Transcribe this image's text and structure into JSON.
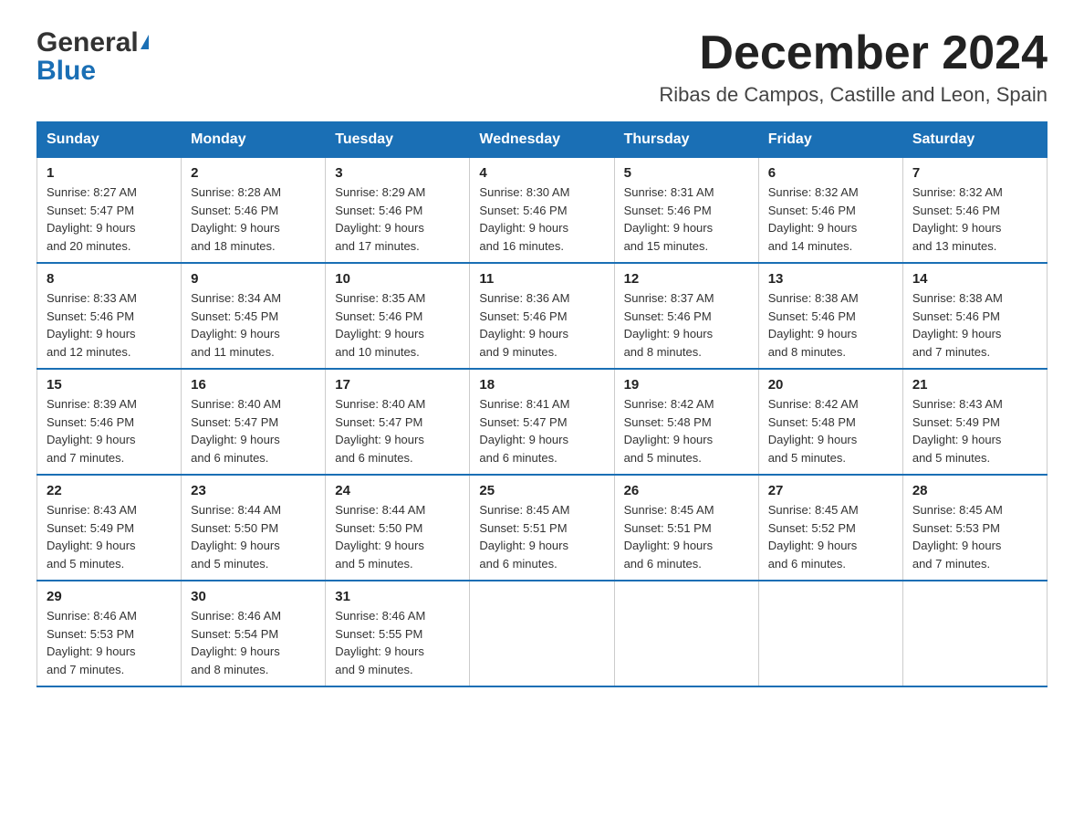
{
  "header": {
    "title": "December 2024",
    "subtitle": "Ribas de Campos, Castille and Leon, Spain",
    "logo_general": "General",
    "logo_blue": "Blue"
  },
  "days_of_week": [
    "Sunday",
    "Monday",
    "Tuesday",
    "Wednesday",
    "Thursday",
    "Friday",
    "Saturday"
  ],
  "weeks": [
    [
      {
        "day": "1",
        "sunrise": "8:27 AM",
        "sunset": "5:47 PM",
        "daylight": "9 hours and 20 minutes."
      },
      {
        "day": "2",
        "sunrise": "8:28 AM",
        "sunset": "5:46 PM",
        "daylight": "9 hours and 18 minutes."
      },
      {
        "day": "3",
        "sunrise": "8:29 AM",
        "sunset": "5:46 PM",
        "daylight": "9 hours and 17 minutes."
      },
      {
        "day": "4",
        "sunrise": "8:30 AM",
        "sunset": "5:46 PM",
        "daylight": "9 hours and 16 minutes."
      },
      {
        "day": "5",
        "sunrise": "8:31 AM",
        "sunset": "5:46 PM",
        "daylight": "9 hours and 15 minutes."
      },
      {
        "day": "6",
        "sunrise": "8:32 AM",
        "sunset": "5:46 PM",
        "daylight": "9 hours and 14 minutes."
      },
      {
        "day": "7",
        "sunrise": "8:32 AM",
        "sunset": "5:46 PM",
        "daylight": "9 hours and 13 minutes."
      }
    ],
    [
      {
        "day": "8",
        "sunrise": "8:33 AM",
        "sunset": "5:46 PM",
        "daylight": "9 hours and 12 minutes."
      },
      {
        "day": "9",
        "sunrise": "8:34 AM",
        "sunset": "5:45 PM",
        "daylight": "9 hours and 11 minutes."
      },
      {
        "day": "10",
        "sunrise": "8:35 AM",
        "sunset": "5:46 PM",
        "daylight": "9 hours and 10 minutes."
      },
      {
        "day": "11",
        "sunrise": "8:36 AM",
        "sunset": "5:46 PM",
        "daylight": "9 hours and 9 minutes."
      },
      {
        "day": "12",
        "sunrise": "8:37 AM",
        "sunset": "5:46 PM",
        "daylight": "9 hours and 8 minutes."
      },
      {
        "day": "13",
        "sunrise": "8:38 AM",
        "sunset": "5:46 PM",
        "daylight": "9 hours and 8 minutes."
      },
      {
        "day": "14",
        "sunrise": "8:38 AM",
        "sunset": "5:46 PM",
        "daylight": "9 hours and 7 minutes."
      }
    ],
    [
      {
        "day": "15",
        "sunrise": "8:39 AM",
        "sunset": "5:46 PM",
        "daylight": "9 hours and 7 minutes."
      },
      {
        "day": "16",
        "sunrise": "8:40 AM",
        "sunset": "5:47 PM",
        "daylight": "9 hours and 6 minutes."
      },
      {
        "day": "17",
        "sunrise": "8:40 AM",
        "sunset": "5:47 PM",
        "daylight": "9 hours and 6 minutes."
      },
      {
        "day": "18",
        "sunrise": "8:41 AM",
        "sunset": "5:47 PM",
        "daylight": "9 hours and 6 minutes."
      },
      {
        "day": "19",
        "sunrise": "8:42 AM",
        "sunset": "5:48 PM",
        "daylight": "9 hours and 5 minutes."
      },
      {
        "day": "20",
        "sunrise": "8:42 AM",
        "sunset": "5:48 PM",
        "daylight": "9 hours and 5 minutes."
      },
      {
        "day": "21",
        "sunrise": "8:43 AM",
        "sunset": "5:49 PM",
        "daylight": "9 hours and 5 minutes."
      }
    ],
    [
      {
        "day": "22",
        "sunrise": "8:43 AM",
        "sunset": "5:49 PM",
        "daylight": "9 hours and 5 minutes."
      },
      {
        "day": "23",
        "sunrise": "8:44 AM",
        "sunset": "5:50 PM",
        "daylight": "9 hours and 5 minutes."
      },
      {
        "day": "24",
        "sunrise": "8:44 AM",
        "sunset": "5:50 PM",
        "daylight": "9 hours and 5 minutes."
      },
      {
        "day": "25",
        "sunrise": "8:45 AM",
        "sunset": "5:51 PM",
        "daylight": "9 hours and 6 minutes."
      },
      {
        "day": "26",
        "sunrise": "8:45 AM",
        "sunset": "5:51 PM",
        "daylight": "9 hours and 6 minutes."
      },
      {
        "day": "27",
        "sunrise": "8:45 AM",
        "sunset": "5:52 PM",
        "daylight": "9 hours and 6 minutes."
      },
      {
        "day": "28",
        "sunrise": "8:45 AM",
        "sunset": "5:53 PM",
        "daylight": "9 hours and 7 minutes."
      }
    ],
    [
      {
        "day": "29",
        "sunrise": "8:46 AM",
        "sunset": "5:53 PM",
        "daylight": "9 hours and 7 minutes."
      },
      {
        "day": "30",
        "sunrise": "8:46 AM",
        "sunset": "5:54 PM",
        "daylight": "9 hours and 8 minutes."
      },
      {
        "day": "31",
        "sunrise": "8:46 AM",
        "sunset": "5:55 PM",
        "daylight": "9 hours and 9 minutes."
      },
      null,
      null,
      null,
      null
    ]
  ],
  "labels": {
    "sunrise": "Sunrise:",
    "sunset": "Sunset:",
    "daylight": "Daylight:"
  }
}
